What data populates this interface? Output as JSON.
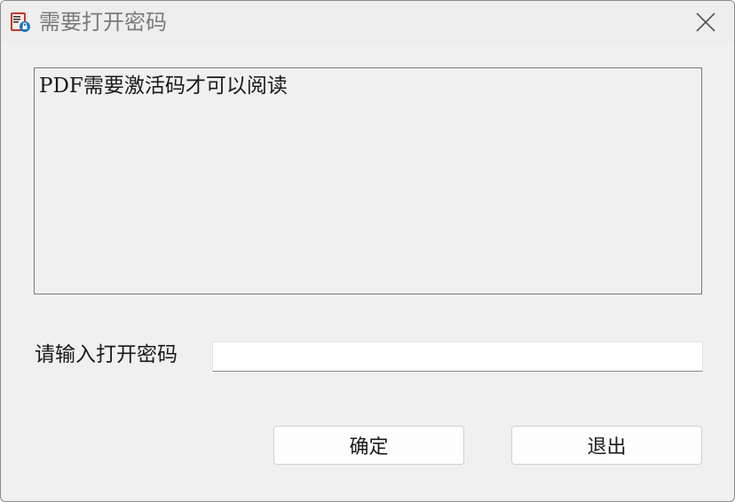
{
  "window": {
    "title": "需要打开密码",
    "app_icon": "pdf-lock-icon",
    "close_icon": "close-icon"
  },
  "message": {
    "text": "PDF需要激活码才可以阅读"
  },
  "password": {
    "label": "请输入打开密码",
    "value": "",
    "placeholder": ""
  },
  "buttons": {
    "ok_label": "确定",
    "exit_label": "退出"
  },
  "colors": {
    "window_bg": "#f0f0f0",
    "title_text": "#7a7a7a",
    "border": "#7a7a7a"
  }
}
